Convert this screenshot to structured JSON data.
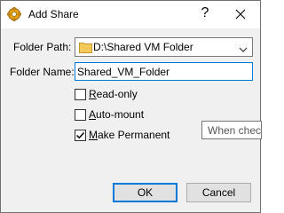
{
  "window": {
    "title": "Add Share",
    "help_glyph": "?",
    "title_icon": "virtualbox-gear-icon",
    "close_icon": "close-icon"
  },
  "form": {
    "folder_path_label": "Folder Path:",
    "folder_path_value": "D:\\Shared VM Folder",
    "folder_name_label": "Folder Name:",
    "folder_name_value": "Shared_VM_Folder",
    "read_only": {
      "label": "Read-only",
      "checked": false
    },
    "auto_mount": {
      "label": "Auto-mount",
      "checked": false
    },
    "make_permanent": {
      "label": "Make Permanent",
      "checked": true
    }
  },
  "tooltip": {
    "text": "When checked"
  },
  "buttons": {
    "ok": "OK",
    "cancel": "Cancel"
  },
  "colors": {
    "accent": "#0078d7",
    "window_bg": "#f0f0f0",
    "folder": "#e8b84a"
  }
}
